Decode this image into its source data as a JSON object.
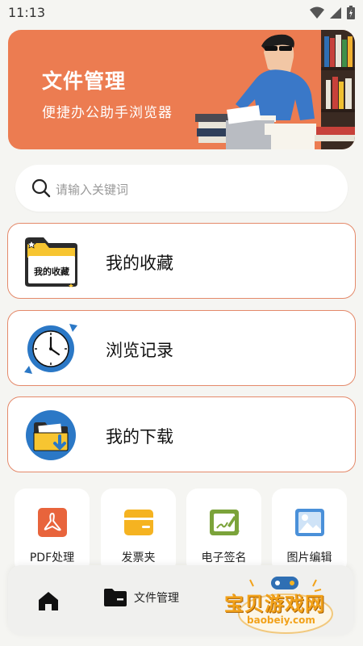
{
  "status_bar": {
    "time": "11:13",
    "icons": [
      "wifi-icon",
      "signal-icon",
      "battery-icon"
    ]
  },
  "banner": {
    "title": "文件管理",
    "subtitle": "便捷办公助手浏览器",
    "background": "#ec7c51"
  },
  "search": {
    "placeholder": "请输入关键词"
  },
  "menu": [
    {
      "label": "我的收藏",
      "icon": "folder-favorites-icon",
      "icon_text": "我的收藏"
    },
    {
      "label": "浏览记录",
      "icon": "clock-history-icon"
    },
    {
      "label": "我的下载",
      "icon": "folder-download-icon"
    }
  ],
  "tools": [
    {
      "label": "PDF处理",
      "icon": "pdf-icon",
      "color": "#e8643c"
    },
    {
      "label": "发票夹",
      "icon": "wallet-icon",
      "color": "#f5b321"
    },
    {
      "label": "电子签名",
      "icon": "signature-icon",
      "color": "#7ba33a"
    },
    {
      "label": "图片编辑",
      "icon": "image-icon",
      "color": "#4a90d9"
    }
  ],
  "bottom_nav": {
    "items": [
      {
        "label": "",
        "icon": "home-icon"
      },
      {
        "label": "文件管理",
        "icon": "folder-icon"
      }
    ]
  },
  "watermark": {
    "text": "宝贝游戏网",
    "url": "baobeiy.com"
  },
  "colors": {
    "accent": "#ec7c51",
    "card_border": "#e4896a",
    "background": "#f5f5f2"
  }
}
